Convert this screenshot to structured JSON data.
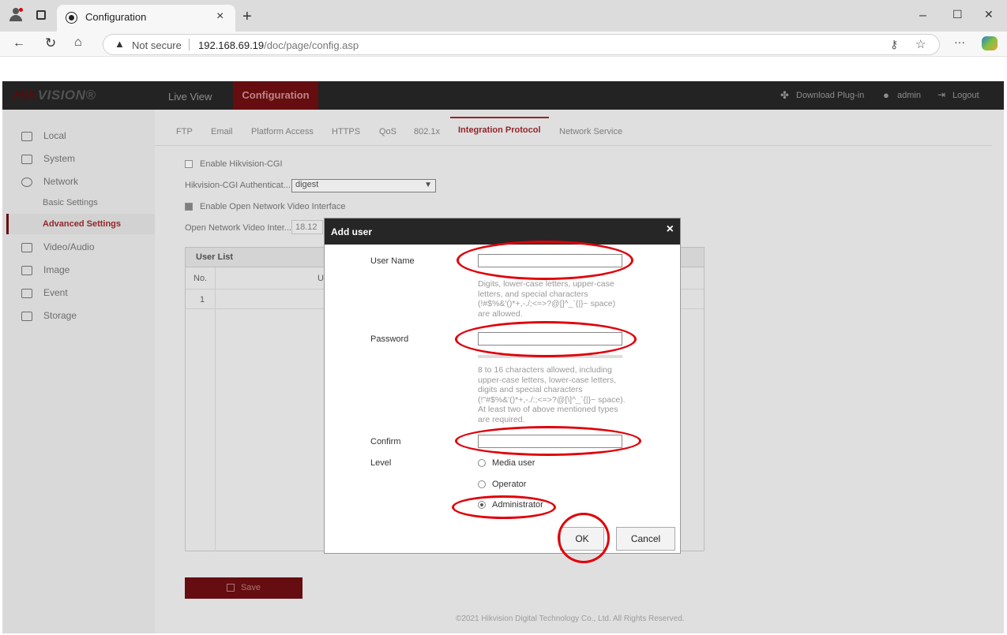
{
  "browser": {
    "tab_title": "Configuration",
    "tab_close": "×",
    "new_tab": "+",
    "security": "Not secure",
    "url_host": "192.168.69.19",
    "url_path": "/doc/page/config.asp",
    "menu": "···",
    "minimize": "–",
    "maximize": "☐",
    "close": "✕"
  },
  "app": {
    "logo_red": "HIK",
    "logo_rest": "VISION®",
    "nav_live": "Live View",
    "nav_config": "Configuration",
    "download_plugin": "Download Plug-in",
    "user": "admin",
    "logout": "Logout"
  },
  "sidebar": {
    "local": "Local",
    "system": "System",
    "network": "Network",
    "basic_settings": "Basic Settings",
    "advanced_settings": "Advanced Settings",
    "video_audio": "Video/Audio",
    "image": "Image",
    "event": "Event",
    "storage": "Storage"
  },
  "subtabs": [
    "FTP",
    "Email",
    "Platform Access",
    "HTTPS",
    "QoS",
    "802.1x",
    "Integration Protocol",
    "Network Service"
  ],
  "content": {
    "enable_cgi": "Enable Hikvision-CGI",
    "cgi_auth_label": "Hikvision-CGI Authenticat...",
    "cgi_auth_value": "digest",
    "enable_onvif": "Enable Open Network Video Interface",
    "onvif_label": "Open Network Video Inter...",
    "onvif_value": "18.12",
    "user_list": "User List",
    "col_no": "No.",
    "col_u": "U",
    "row_no": "1",
    "save": "Save",
    "footer": "©2021 Hikvision Digital Technology Co., Ltd. All Rights Reserved."
  },
  "dialog": {
    "title": "Add user",
    "close": "×",
    "user_name_label": "User Name",
    "user_name_hint": "Digits, lower-case letters, upper-case letters, and special characters (!#$%&'()*+,-./;<=>?@[]^_`{|}~ space) are allowed.",
    "password_label": "Password",
    "password_hint": "8 to 16 characters allowed, including upper-case letters, lower-case letters, digits and special characters (!\"#$%&'()*+,-./:;<=>?@[\\]^_`{|}~ space). At least two of above mentioned types are required.",
    "confirm_label": "Confirm",
    "level_label": "Level",
    "levels": [
      "Media user",
      "Operator",
      "Administrator"
    ],
    "selected_level": "Administrator",
    "ok": "OK",
    "cancel": "Cancel"
  },
  "colors": {
    "brand_red": "#6e0f12",
    "annotation_red": "#e0000a"
  }
}
